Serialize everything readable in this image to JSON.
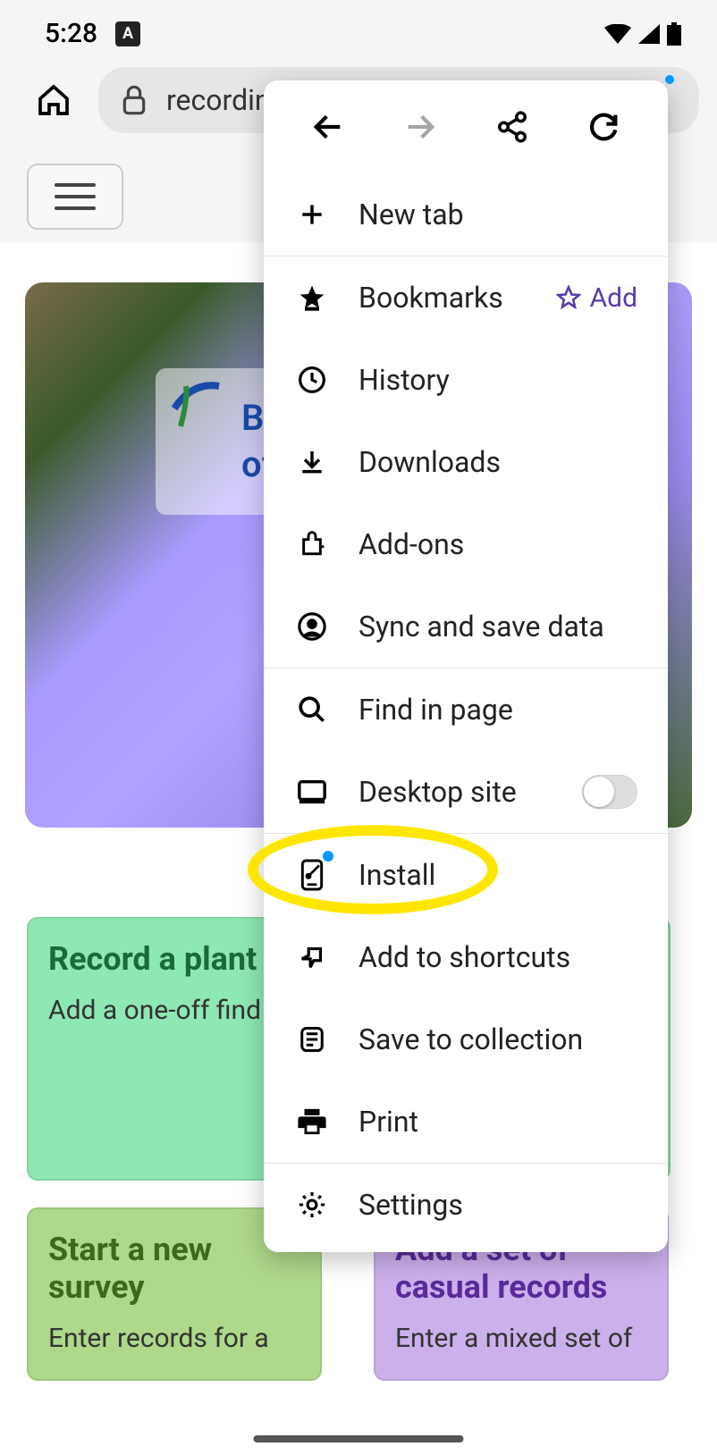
{
  "status": {
    "time": "5:28",
    "keyboard_badge": "A"
  },
  "urlbar": {
    "text": "recording"
  },
  "page": {
    "badge_line1": "Bo",
    "badge_line2": "of",
    "card_record": {
      "title": "Record a plant",
      "body": "Add a one-off find quickly."
    },
    "card_survey": {
      "title": "Start a new survey",
      "body": "Enter records for a"
    },
    "card_casual": {
      "title": "Add a set of casual records",
      "body": "Enter a mixed set of"
    }
  },
  "menu": {
    "new_tab": "New tab",
    "bookmarks": "Bookmarks",
    "bookmarks_add": "Add",
    "history": "History",
    "downloads": "Downloads",
    "addons": "Add-ons",
    "sync": "Sync and save data",
    "find": "Find in page",
    "desktop": "Desktop site",
    "install": "Install",
    "shortcuts": "Add to shortcuts",
    "collection": "Save to collection",
    "print": "Print",
    "settings": "Settings"
  }
}
